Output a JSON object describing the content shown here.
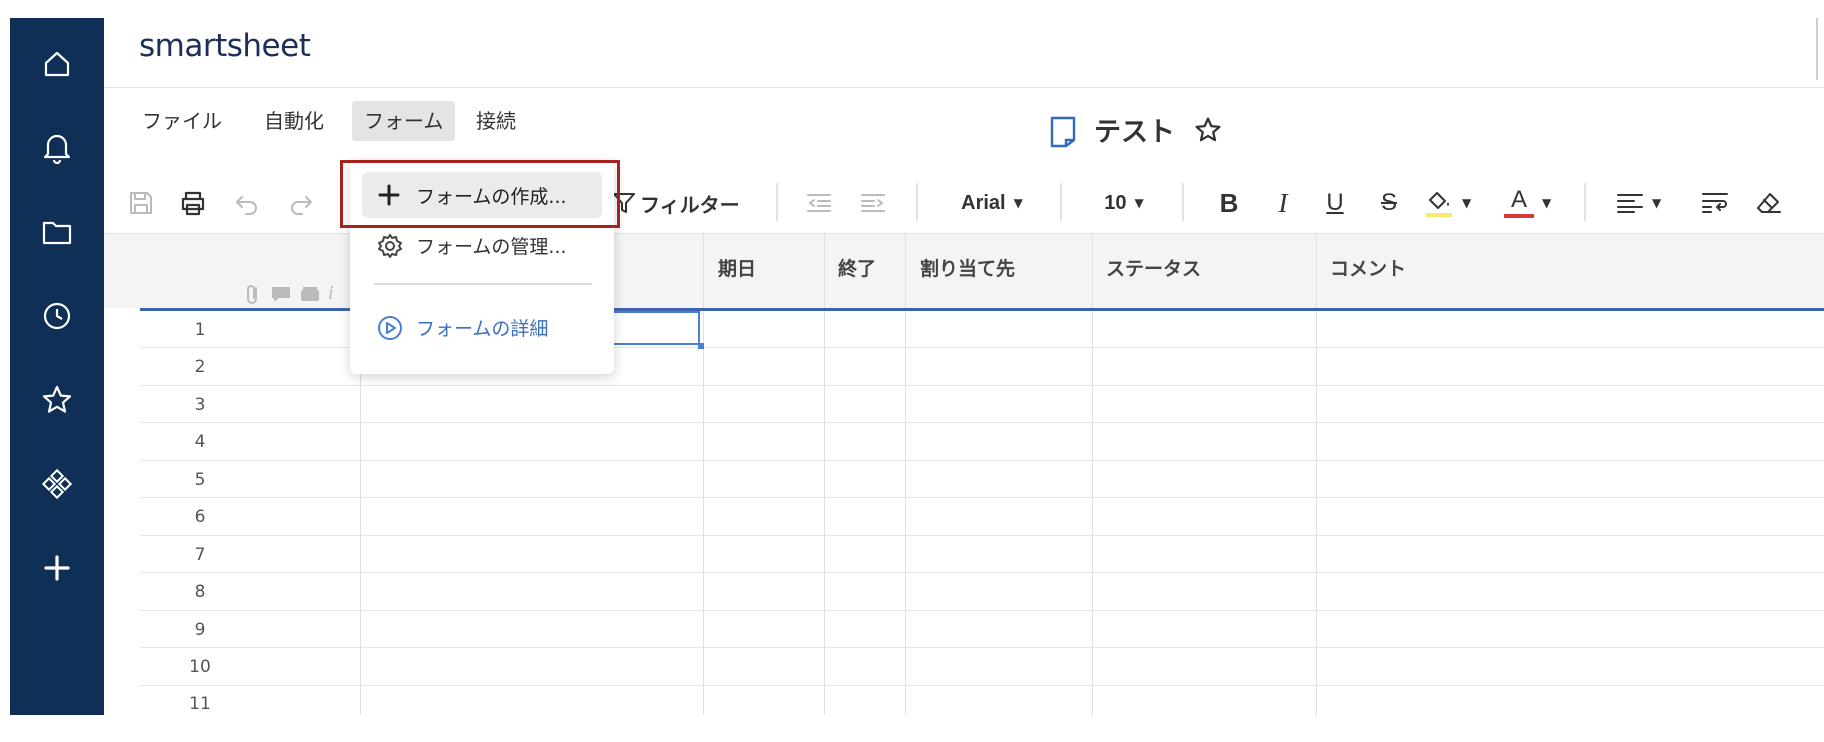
{
  "app": {
    "logo": "smartsheet"
  },
  "rail": {
    "items": [
      "home-icon",
      "bell-icon",
      "folder-icon",
      "clock-icon",
      "star-icon",
      "apps-icon",
      "plus-icon"
    ],
    "color": "#0f2f57"
  },
  "menu": {
    "items": [
      "ファイル",
      "自動化",
      "フォーム",
      "接続"
    ],
    "active": "フォーム"
  },
  "sheet": {
    "title": "テスト"
  },
  "toolbar": {
    "filter_label": "フィルター",
    "font_name": "Arial",
    "font_size": "10",
    "bold": "B",
    "italic": "I",
    "underline": "U",
    "strike": "S",
    "text_color": "A",
    "highlight_color": "#f5e86a",
    "font_color": "#d83a34"
  },
  "dropdown": {
    "create": "フォームの作成...",
    "manage": "フォームの管理...",
    "details": "フォームの詳細",
    "highlight_border": "#a6221c"
  },
  "grid": {
    "columns": [
      "期日",
      "終了",
      "割り当て先",
      "ステータス",
      "コメント"
    ],
    "rows": [
      "1",
      "2",
      "3",
      "4",
      "5",
      "6",
      "7",
      "8",
      "9",
      "10",
      "11"
    ]
  }
}
